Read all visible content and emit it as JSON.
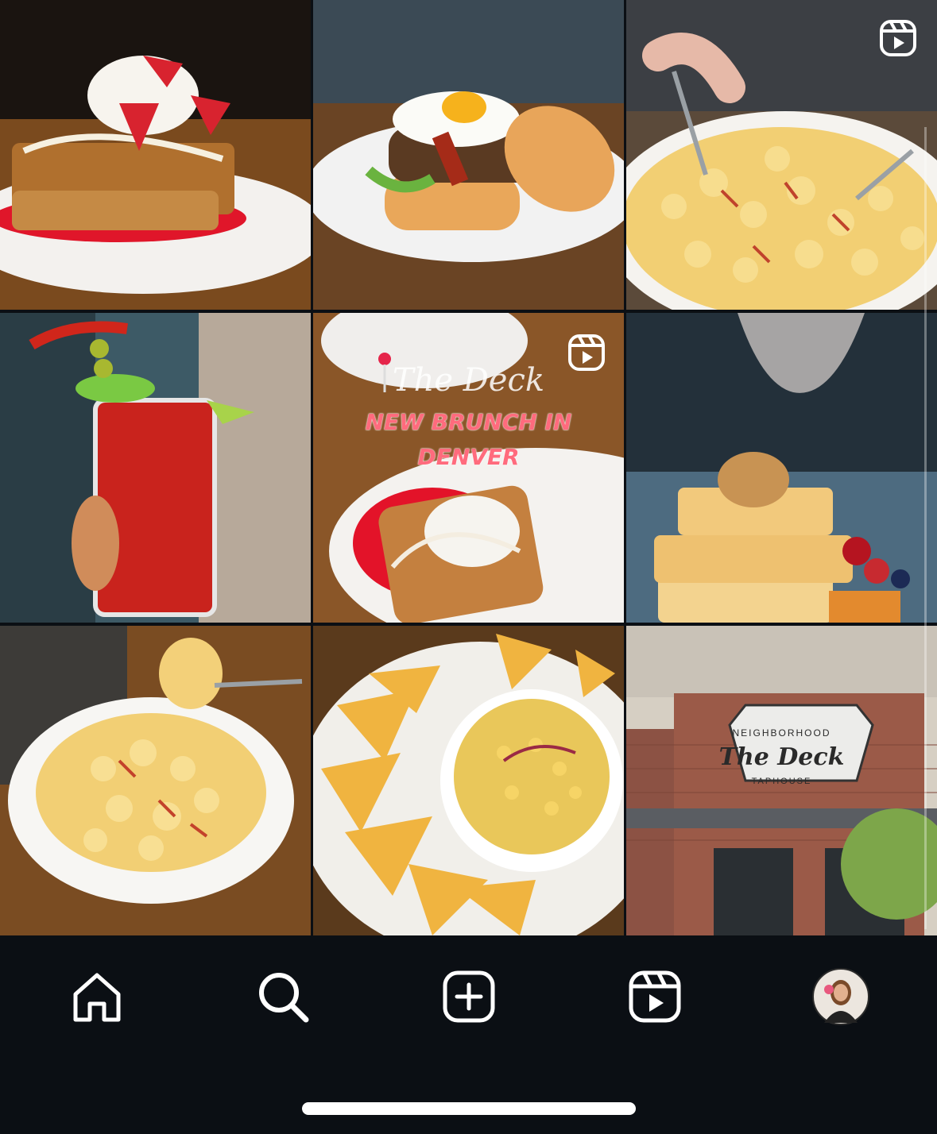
{
  "grid": {
    "tiles": [
      {
        "subject": "strawberry french toast",
        "reel": false
      },
      {
        "subject": "breakfast burger with egg and bacon",
        "reel": false
      },
      {
        "subject": "mac and cheese",
        "reel": true
      },
      {
        "subject": "bloody mary",
        "reel": false
      },
      {
        "subject": "brunch reel",
        "reel": true
      },
      {
        "subject": "waffles",
        "reel": false
      },
      {
        "subject": "mac and cheese bowl",
        "reel": false
      },
      {
        "subject": "chips and corn dip",
        "reel": false
      },
      {
        "subject": "The Deck storefront",
        "reel": false
      }
    ],
    "reel_overlay": {
      "brand_script": "The Deck",
      "headline_line1": "NEW BRUNCH IN",
      "headline_line2": "DENVER"
    },
    "storefront_sign": {
      "top": "NEIGHBORHOOD",
      "main": "The Deck",
      "bottom": "TAPHOUSE"
    }
  },
  "nav": {
    "items": [
      "home-icon",
      "search-icon",
      "create-icon",
      "reels-icon",
      "profile-avatar"
    ]
  },
  "colors": {
    "background": "#0b0f14",
    "icon": "#ffffff",
    "headline": "#ff6b7d"
  }
}
